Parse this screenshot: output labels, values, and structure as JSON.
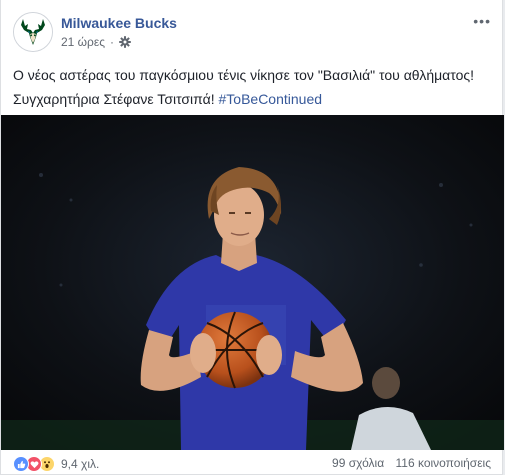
{
  "post": {
    "page_name": "Milwaukee Bucks",
    "timestamp": "21 ώρες",
    "separator": "·",
    "privacy_icon": "gear-icon",
    "more_icon": "more-options-icon",
    "more_label": "•••",
    "text_line_1": "Ο νέος αστέρας του παγκόσμιου τένις νίκησε τον \"Βασιλιά\" του αθλήματος!",
    "text_line_2": "Συγχαρητήρια Στέφανε Τσιτσιπά!",
    "hashtag": "#ToBeContinued"
  },
  "footer": {
    "reaction_icons": [
      "like-reaction-icon",
      "love-reaction-icon",
      "wow-reaction-icon"
    ],
    "reaction_count": "9,4 χιλ.",
    "comments": "99 σχόλια",
    "shares": "116 κοινοποιήσεις"
  },
  "colors": {
    "link": "#385898",
    "hashtag": "#365899",
    "text": "#1d2129",
    "muted": "#606770",
    "like": "#5890ff",
    "love": "#f25268",
    "wow": "#fcd56a",
    "bucks_green": "#00471b",
    "shirt_blue": "#2f38a8",
    "ball_orange": "#c95a23"
  }
}
